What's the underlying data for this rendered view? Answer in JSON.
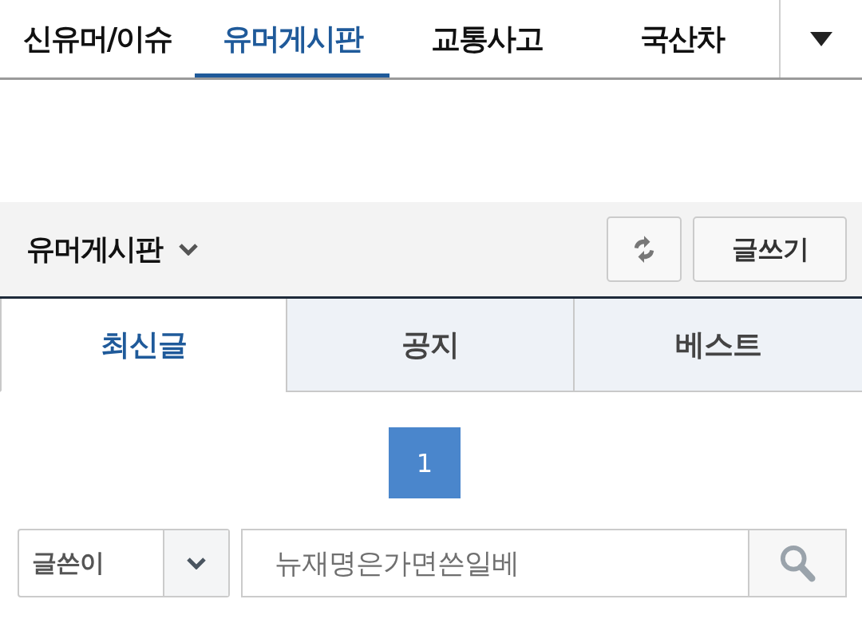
{
  "nav": {
    "tabs": [
      {
        "label": "신유머/이슈",
        "selected": false
      },
      {
        "label": "유머게시판",
        "selected": true
      },
      {
        "label": "교통사고",
        "selected": false
      },
      {
        "label": "국산차",
        "selected": false
      }
    ]
  },
  "board": {
    "title": "유머게시판",
    "write_button": "글쓰기"
  },
  "list_tabs": [
    {
      "label": "최신글",
      "selected": true
    },
    {
      "label": "공지",
      "selected": false
    },
    {
      "label": "베스트",
      "selected": false
    }
  ],
  "pagination": {
    "pages": [
      {
        "label": "1",
        "selected": true
      }
    ]
  },
  "search": {
    "filter": "글쓴이",
    "query": "뉴재명은가면쓴일베"
  }
}
